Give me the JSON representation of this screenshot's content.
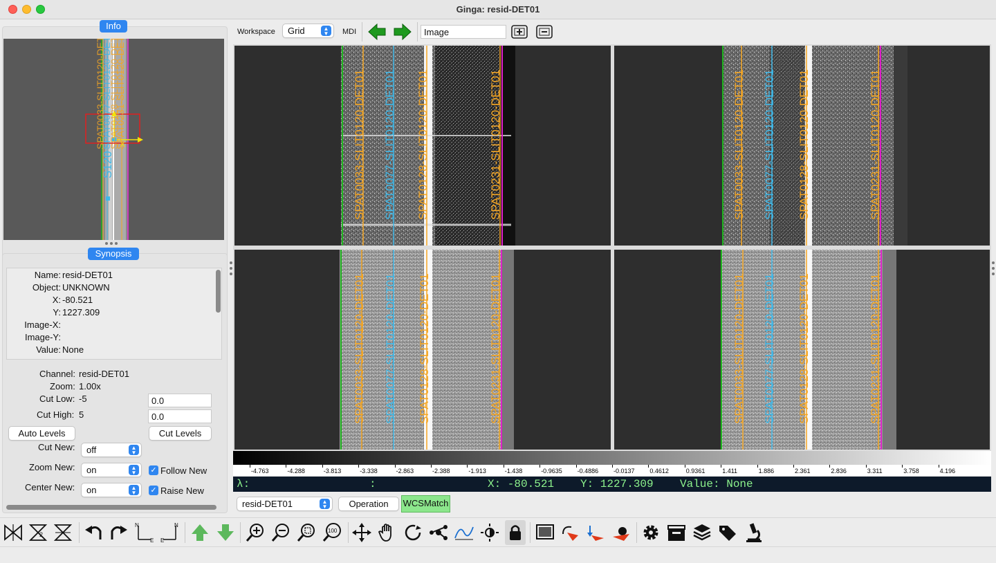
{
  "window": {
    "title": "Ginga: resid-DET01"
  },
  "colors": {
    "accent": "#2f86f0",
    "orange": "#f5a623",
    "cyan": "#3fb8e8",
    "green": "#1fb51f",
    "magenta": "#e020c8",
    "readout_bg": "#0d1a2a",
    "readout_fg": "#8cf28c",
    "wcsmatch_bg": "#8ce68c"
  },
  "left": {
    "info_tab": "Info",
    "synopsis_tab": "Synopsis",
    "pan_labels": [
      "SPAT0033-SLIT0120-DET01",
      "SPAT0077-SLIT0120-DET01",
      "SPAT0128-SLIT0120-DET01",
      "SPAT0231-SLIT0120-DET01"
    ],
    "pan_s_label": "S120",
    "pan_x_label": "X",
    "info": [
      {
        "label": "Name:",
        "value": "resid-DET01"
      },
      {
        "label": "Object:",
        "value": "UNKNOWN"
      },
      {
        "label": "X:",
        "value": "-80.521"
      },
      {
        "label": "Y:",
        "value": "1227.309"
      },
      {
        "label": "Image-X:",
        "value": ""
      },
      {
        "label": "Image-Y:",
        "value": ""
      },
      {
        "label": "Value:",
        "value": "None"
      }
    ],
    "channel_label": "Channel:",
    "channel_value": "resid-DET01",
    "zoom_label": "Zoom:",
    "zoom_value": "1.00x",
    "cutlow_label": "Cut Low:",
    "cutlow_value": "-5",
    "cutlow_field": "0.0",
    "cuthigh_label": "Cut High:",
    "cuthigh_value": "5",
    "cuthigh_field": "0.0",
    "auto_levels": "Auto Levels",
    "cut_levels": "Cut Levels",
    "cutnew_label": "Cut New:",
    "cutnew_value": "off",
    "zoomnew_label": "Zoom New:",
    "zoomnew_value": "on",
    "centernew_label": "Center New:",
    "centernew_value": "on",
    "follow_new": "Follow New",
    "raise_new": "Raise New"
  },
  "topbar": {
    "workspace_label": "Workspace",
    "workspace_value": "Grid",
    "mdi_label": "MDI",
    "image_field": "Image"
  },
  "viewers": {
    "labels": [
      "SPAT0033-SLIT0120-DET01",
      "SPAT0077-SLIT0120-DET01",
      "SPAT0128-SLIT0120-DET01",
      "SPAT0231-SLIT0120-DET01"
    ]
  },
  "colorbar": {
    "ticks": [
      "-4.763",
      "-4.288",
      "-3.813",
      "-3.338",
      "-2.863",
      "-2.388",
      "-1.913",
      "-1.438",
      "-0.9635",
      "-0.4886",
      "-0.0137",
      "0.4612",
      "0.9361",
      "1.411",
      "1.886",
      "2.361",
      "2.836",
      "3.311",
      "3.758",
      "4.196"
    ]
  },
  "readout": {
    "lambda": "λ:",
    "colon": ":",
    "x": "X: -80.521",
    "y": "Y: 1227.309",
    "value": "Value: None"
  },
  "bottom": {
    "channel_value": "resid-DET01",
    "operation": "Operation",
    "wcsmatch": "WCSMatch"
  },
  "toolbar": {
    "icons": [
      "flip-x-icon",
      "flip-y-icon",
      "swap-xy-icon",
      "rotate-ccw-icon",
      "rotate-cw-icon",
      "orient-ne-icon",
      "orient-ne-alt-icon",
      "prev-image-icon",
      "next-image-icon",
      "zoom-in-icon",
      "zoom-out-icon",
      "zoom-fit-icon",
      "zoom-100-icon",
      "pan-icon",
      "hand-icon",
      "cycle-icon",
      "network-icon",
      "contrast-icon",
      "brightness-icon",
      "lock-icon",
      "screen-icon",
      "undo-cut-icon",
      "cut-down-icon",
      "cut-reset-icon",
      "settings-icon",
      "clapper-icon",
      "layers-icon",
      "tags-icon",
      "microscope-icon"
    ],
    "labels": {
      "n": "N",
      "e": "E",
      "zoom100": "100"
    }
  }
}
